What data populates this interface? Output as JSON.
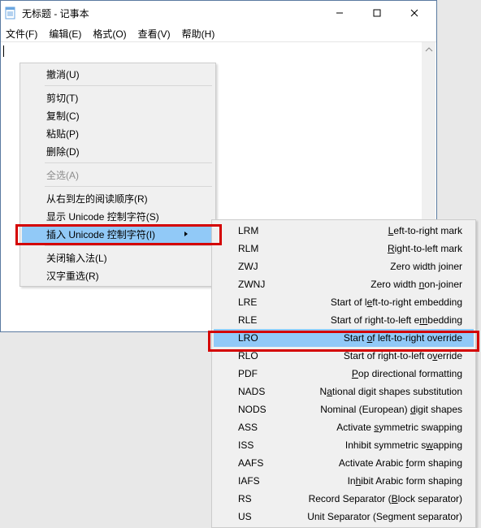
{
  "window": {
    "title": "无标题 - 记事本",
    "min_tooltip": "Minimize",
    "max_tooltip": "Maximize",
    "close_tooltip": "Close"
  },
  "menubar": {
    "file": "文件(F)",
    "edit": "编辑(E)",
    "format": "格式(O)",
    "view": "查看(V)",
    "help": "帮助(H)"
  },
  "context_menu": [
    {
      "label": "撤消(U)",
      "disabled": false
    },
    {
      "sep": true
    },
    {
      "label": "剪切(T)",
      "disabled": false
    },
    {
      "label": "复制(C)",
      "disabled": false
    },
    {
      "label": "粘贴(P)",
      "disabled": false
    },
    {
      "label": "删除(D)",
      "disabled": false
    },
    {
      "sep": true
    },
    {
      "label": "全选(A)",
      "disabled": true
    },
    {
      "sep": true
    },
    {
      "label": "从右到左的阅读顺序(R)",
      "disabled": false
    },
    {
      "label": "显示 Unicode 控制字符(S)",
      "disabled": false
    },
    {
      "label": "插入 Unicode 控制字符(I)",
      "disabled": false,
      "submenu": true,
      "highlight": true
    },
    {
      "sep": true
    },
    {
      "label": "关闭输入法(L)",
      "disabled": false
    },
    {
      "label": "汉字重选(R)",
      "disabled": false
    }
  ],
  "submenu": [
    {
      "code": "LRM",
      "desc": "Left-to-right mark",
      "u": "L"
    },
    {
      "code": "RLM",
      "desc": "Right-to-left mark",
      "u": "R"
    },
    {
      "code": "ZWJ",
      "desc": "Zero width joiner",
      "u": "j"
    },
    {
      "code": "ZWNJ",
      "desc": "Zero width non-joiner",
      "u": "n"
    },
    {
      "code": "LRE",
      "desc": "Start of left-to-right embedding",
      "u": "e"
    },
    {
      "code": "RLE",
      "desc": "Start of right-to-left embedding",
      "u": "m"
    },
    {
      "code": "LRO",
      "desc": "Start of left-to-right override",
      "u": "o",
      "highlight": true
    },
    {
      "code": "RLO",
      "desc": "Start of right-to-left override",
      "u": "v"
    },
    {
      "code": "PDF",
      "desc": "Pop directional formatting",
      "u": "P"
    },
    {
      "code": "NADS",
      "desc": "National digit shapes substitution",
      "u": "a"
    },
    {
      "code": "NODS",
      "desc": "Nominal (European) digit shapes",
      "u": "d"
    },
    {
      "code": "ASS",
      "desc": "Activate symmetric swapping",
      "u": "s"
    },
    {
      "code": "ISS",
      "desc": "Inhibit symmetric swapping",
      "u": "w"
    },
    {
      "code": "AAFS",
      "desc": "Activate Arabic form shaping",
      "u": "f"
    },
    {
      "code": "IAFS",
      "desc": "Inhibit Arabic form shaping",
      "u": "h"
    },
    {
      "code": "RS",
      "desc": "Record Separator (Block separator)",
      "u": "B"
    },
    {
      "code": "US",
      "desc": "Unit Separator (Segment separator)",
      "u": "g"
    }
  ]
}
